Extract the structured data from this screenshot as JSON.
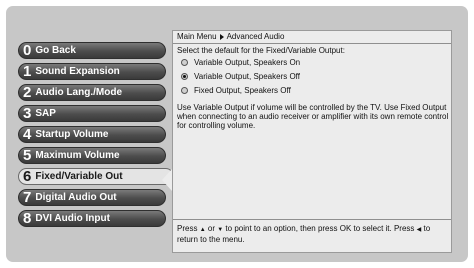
{
  "menu": {
    "items": [
      {
        "num": "0",
        "label": "Go Back"
      },
      {
        "num": "1",
        "label": "Sound Expansion"
      },
      {
        "num": "2",
        "label": "Audio Lang./Mode"
      },
      {
        "num": "3",
        "label": "SAP"
      },
      {
        "num": "4",
        "label": "Startup Volume"
      },
      {
        "num": "5",
        "label": "Maximum Volume"
      },
      {
        "num": "6",
        "label": "Fixed/Variable Out"
      },
      {
        "num": "7",
        "label": "Digital Audio Out"
      },
      {
        "num": "8",
        "label": "DVI Audio Input"
      }
    ],
    "selected_index": 6
  },
  "panel": {
    "breadcrumb": {
      "parent": "Main Menu",
      "current": "Advanced Audio"
    },
    "prompt": "Select the default for the Fixed/Variable Output:",
    "options": [
      {
        "label": "Variable Output, Speakers On",
        "selected": false
      },
      {
        "label": "Variable Output, Speakers Off",
        "selected": true
      },
      {
        "label": "Fixed Output, Speakers Off",
        "selected": false
      }
    ],
    "description": "Use Variable Output if volume will be controlled by the TV. Use Fixed Output when connecting to an audio receiver or amplifier with its own remote control for controlling volume.",
    "footer": {
      "part1": "Press",
      "up_glyph": "▲",
      "or": "or",
      "down_glyph": "▼",
      "part2": "to point to an option, then press OK to select it. Press",
      "left_glyph": "◀",
      "part3": "to return to the menu."
    }
  },
  "colors": {
    "screen_bg": "#c7c7c7",
    "panel_bg": "#ececec",
    "button_dark": "#4c4c4c",
    "button_selected": "#e4e4e4"
  }
}
